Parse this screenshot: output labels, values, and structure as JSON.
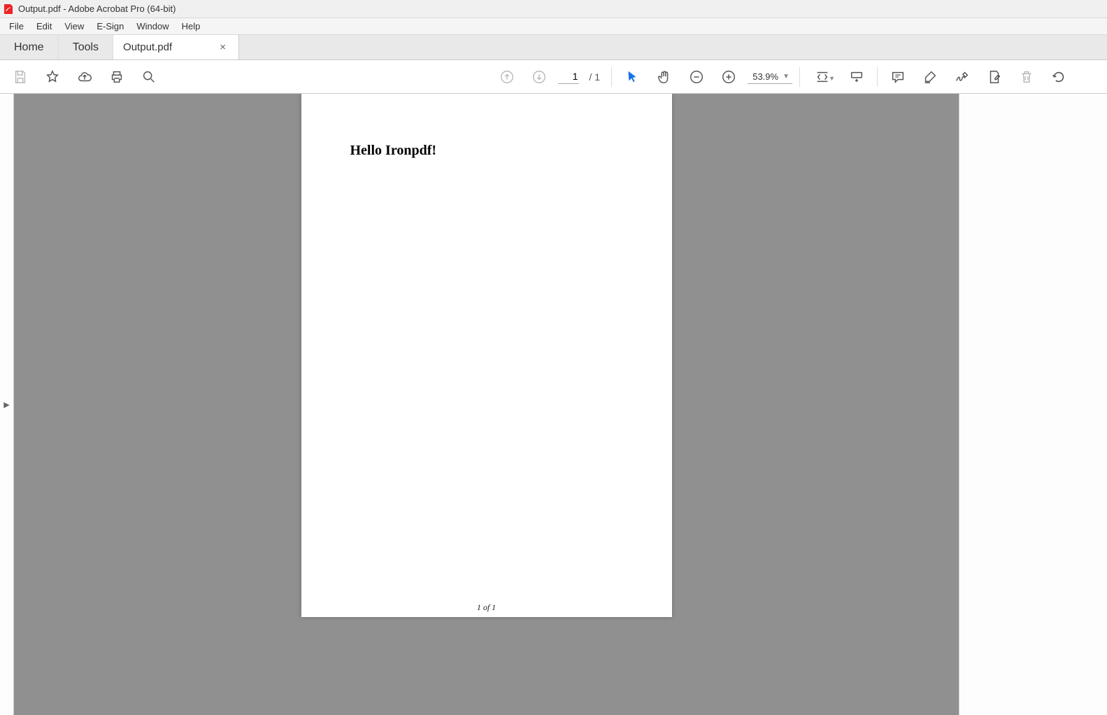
{
  "window": {
    "title": "Output.pdf - Adobe Acrobat Pro (64-bit)"
  },
  "menubar": {
    "items": [
      "File",
      "Edit",
      "View",
      "E-Sign",
      "Window",
      "Help"
    ]
  },
  "tabs": {
    "home": "Home",
    "tools": "Tools",
    "document": "Output.pdf",
    "close_glyph": "×"
  },
  "toolbar": {
    "page_current": "1",
    "page_sep": "/",
    "page_total": "1",
    "zoom_value": "53.9%"
  },
  "document": {
    "heading": "Hello Ironpdf!",
    "footer": "1 of 1"
  }
}
